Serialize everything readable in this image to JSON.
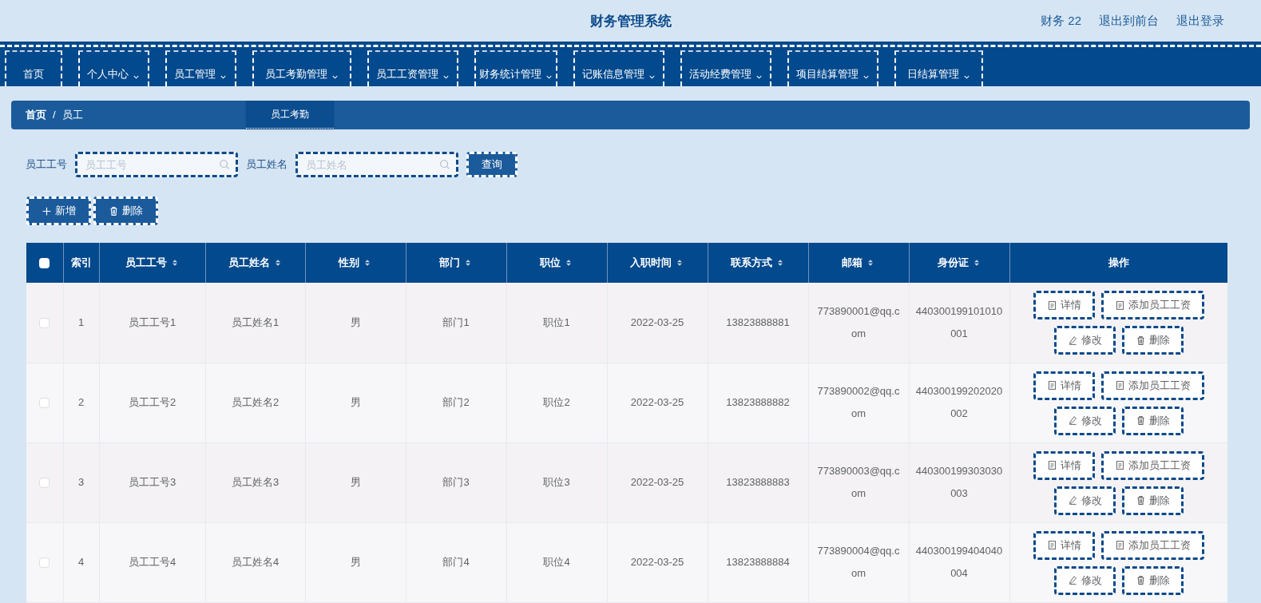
{
  "header": {
    "title": "财务管理系统",
    "user": "财务 22",
    "links": [
      "退出到前台",
      "退出登录"
    ]
  },
  "nav": [
    {
      "label": "首页",
      "dropdown": false
    },
    {
      "label": "个人中心",
      "dropdown": true
    },
    {
      "label": "员工管理",
      "dropdown": true
    },
    {
      "label": "员工考勤管理",
      "dropdown": true,
      "submenu": [
        "员工考勤"
      ]
    },
    {
      "label": "员工工资管理",
      "dropdown": true
    },
    {
      "label": "财务统计管理",
      "dropdown": true
    },
    {
      "label": "记账信息管理",
      "dropdown": true
    },
    {
      "label": "活动经费管理",
      "dropdown": true
    },
    {
      "label": "项目结算管理",
      "dropdown": true
    },
    {
      "label": "日结算管理",
      "dropdown": true
    }
  ],
  "breadcrumb": {
    "items": [
      "首页",
      "员工"
    ],
    "separator": "/"
  },
  "search": [
    {
      "label": "员工工号",
      "placeholder": "员工工号"
    },
    {
      "label": "员工姓名",
      "placeholder": "员工姓名"
    }
  ],
  "search_button": "查询",
  "actions": [
    {
      "kind": "add",
      "label": "新增"
    },
    {
      "kind": "delete",
      "label": "删除"
    }
  ],
  "table": {
    "select_all_checked": false,
    "columns": [
      {
        "label": "索引",
        "sortable": false
      },
      {
        "label": "员工工号",
        "sortable": true
      },
      {
        "label": "员工姓名",
        "sortable": true
      },
      {
        "label": "性别",
        "sortable": true
      },
      {
        "label": "部门",
        "sortable": true
      },
      {
        "label": "职位",
        "sortable": true
      },
      {
        "label": "入职时间",
        "sortable": true
      },
      {
        "label": "联系方式",
        "sortable": true
      },
      {
        "label": "邮箱",
        "sortable": true
      },
      {
        "label": "身份证",
        "sortable": true
      },
      {
        "label": "操作",
        "sortable": false
      }
    ],
    "rows": [
      {
        "checked": false,
        "cells": [
          "1",
          "员工工号1",
          "员工姓名1",
          "男",
          "部门1",
          "职位1",
          "2022-03-25",
          "13823888881",
          "773890001@qq.com",
          "440300199101010001"
        ],
        "actions": [
          {
            "kind": "detail",
            "label": "详情"
          },
          {
            "kind": "detail",
            "label": "添加员工工资"
          },
          {
            "kind": "edit",
            "label": "修改"
          },
          {
            "kind": "delete",
            "label": "删除"
          }
        ]
      },
      {
        "checked": false,
        "cells": [
          "2",
          "员工工号2",
          "员工姓名2",
          "男",
          "部门2",
          "职位2",
          "2022-03-25",
          "13823888882",
          "773890002@qq.com",
          "440300199202020002"
        ],
        "actions": [
          {
            "kind": "detail",
            "label": "详情"
          },
          {
            "kind": "detail",
            "label": "添加员工工资"
          },
          {
            "kind": "edit",
            "label": "修改"
          },
          {
            "kind": "delete",
            "label": "删除"
          }
        ]
      },
      {
        "checked": false,
        "cells": [
          "3",
          "员工工号3",
          "员工姓名3",
          "男",
          "部门3",
          "职位3",
          "2022-03-25",
          "13823888883",
          "773890003@qq.com",
          "440300199303030003"
        ],
        "actions": [
          {
            "kind": "detail",
            "label": "详情"
          },
          {
            "kind": "detail",
            "label": "添加员工工资"
          },
          {
            "kind": "edit",
            "label": "修改"
          },
          {
            "kind": "delete",
            "label": "删除"
          }
        ]
      },
      {
        "checked": false,
        "cells": [
          "4",
          "员工工号4",
          "员工姓名4",
          "男",
          "部门4",
          "职位4",
          "2022-03-25",
          "13823888884",
          "773890004@qq.com",
          "440300199404040004"
        ],
        "actions": [
          {
            "kind": "detail",
            "label": "详情"
          },
          {
            "kind": "detail",
            "label": "添加员工工资"
          },
          {
            "kind": "edit",
            "label": "修改"
          },
          {
            "kind": "delete",
            "label": "删除"
          }
        ]
      }
    ]
  }
}
